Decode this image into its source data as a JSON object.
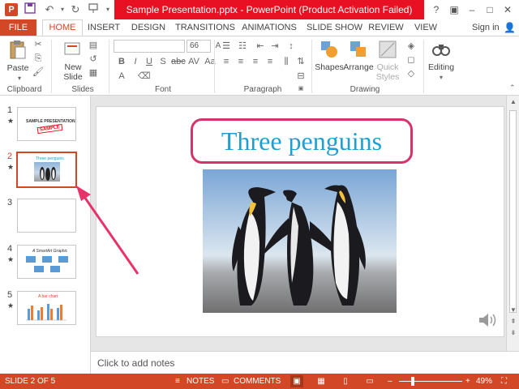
{
  "titlebar": {
    "app_icon": "P",
    "title": "Sample Presentation.pptx - PowerPoint (Product Activation Failed)",
    "qat_icons": [
      "save-icon",
      "undo-icon",
      "redo-icon",
      "start-from-beginning-icon",
      "customize-qat-icon"
    ],
    "window_controls": [
      "help-icon",
      "ribbon-display-icon",
      "minimize-icon",
      "maximize-icon",
      "close-icon"
    ]
  },
  "tabs": {
    "file": "FILE",
    "items": [
      "HOME",
      "INSERT",
      "DESIGN",
      "TRANSITIONS",
      "ANIMATIONS",
      "SLIDE SHOW",
      "REVIEW",
      "VIEW"
    ],
    "active": "HOME",
    "signin": "Sign in"
  },
  "ribbon": {
    "clipboard": {
      "label": "Clipboard",
      "paste": "Paste"
    },
    "slides": {
      "label": "Slides",
      "new_slide_line1": "New",
      "new_slide_line2": "Slide"
    },
    "font": {
      "label": "Font",
      "font_size": "66"
    },
    "paragraph": {
      "label": "Paragraph"
    },
    "drawing": {
      "label": "Drawing",
      "shapes": "Shapes",
      "arrange": "Arrange",
      "quick_styles_line1": "Quick",
      "quick_styles_line2": "Styles"
    },
    "editing": {
      "label": "Editing"
    }
  },
  "thumbnails": [
    {
      "number": "1",
      "star": "★",
      "caption": "SAMPLE PRESENTATION",
      "stamp": "SAMPLE"
    },
    {
      "number": "2",
      "star": "★",
      "caption": "Three penguins",
      "selected": true
    },
    {
      "number": "3",
      "star": ""
    },
    {
      "number": "4",
      "star": "★",
      "caption": "A SmartArt Graphic"
    },
    {
      "number": "5",
      "star": "★",
      "caption": "A bar chart"
    }
  ],
  "slide": {
    "title": "Three penguins"
  },
  "notes": {
    "placeholder": "Click to add notes"
  },
  "statusbar": {
    "slide_info": "SLIDE 2 OF 5",
    "notes": "NOTES",
    "comments": "COMMENTS",
    "zoom": "49%",
    "zoom_level": 0.49,
    "colors": {
      "accent": "#d24726",
      "title_band": "#e81123"
    }
  }
}
